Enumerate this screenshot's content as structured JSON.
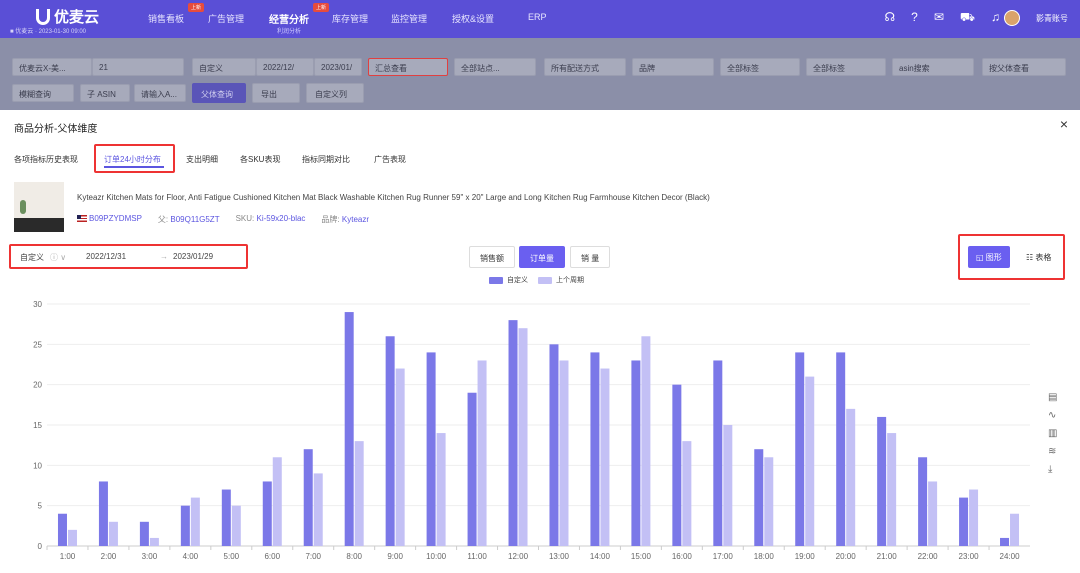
{
  "topnav": {
    "logo": "优麦云",
    "sub_logo": "■ 优麦云 · 2023-01-30 09:00",
    "items": [
      {
        "label": "销售看板",
        "badge": "上新"
      },
      {
        "label": "广告管理",
        "badge": ""
      },
      {
        "label": "经营分析",
        "sub": "利润分析",
        "badge": "上新"
      },
      {
        "label": "库存管理",
        "badge": ""
      },
      {
        "label": "监控管理",
        "badge": ""
      },
      {
        "label": "授权&设置",
        "badge": ""
      },
      {
        "label": "ERP",
        "badge": ""
      }
    ],
    "user": "影青账号"
  },
  "filters": {
    "row1": [
      "优麦云X-美...",
      "21",
      "自定义",
      "2022/12/",
      "2023/01/",
      "汇总查看",
      "全部站点...",
      "所有配送方式",
      "品牌",
      "全部标签",
      "全部标签",
      "asin搜索",
      "按父体查看"
    ],
    "row2": [
      "模糊查询",
      "子 ASIN",
      "请输入A...",
      "父体查询",
      "导出",
      "自定义列"
    ]
  },
  "modal": {
    "title": "商品分析-父体维度",
    "close": "×",
    "tabs": [
      "各项指标历史表现",
      "订单24小时分布",
      "支出明细",
      "各SKU表现",
      "指标同期对比",
      "广告表现"
    ],
    "active_tab": 1,
    "product": {
      "title": "Kyteazr Kitchen Mats for Floor, Anti Fatigue Cushioned Kitchen Mat Black Washable Kitchen Rug Runner 59\" x 20\" Large and Long Kitchen Rug Farmhouse Kitchen Decor (Black)",
      "asin": "B09PZYDMSP",
      "parent_label": "父:",
      "parent": "B09Q11G5ZT",
      "sku_label": "SKU:",
      "sku": "Ki-59x20-blac",
      "brand_label": "品牌:",
      "brand": "Kyteazr"
    },
    "date": {
      "mode": "自定义",
      "start": "2022/12/31",
      "arrow": "→",
      "end": "2023/01/29"
    },
    "metrics": [
      "销售额",
      "订单量",
      "销 量"
    ],
    "active_metric": 1,
    "views": {
      "chart": "图形",
      "table": "表格"
    }
  },
  "chart_data": {
    "type": "bar",
    "categories": [
      "1:00",
      "2:00",
      "3:00",
      "4:00",
      "5:00",
      "6:00",
      "7:00",
      "8:00",
      "9:00",
      "10:00",
      "11:00",
      "12:00",
      "13:00",
      "14:00",
      "15:00",
      "16:00",
      "17:00",
      "18:00",
      "19:00",
      "20:00",
      "21:00",
      "22:00",
      "23:00",
      "24:00"
    ],
    "series": [
      {
        "name": "自定义",
        "color": "#7b78e8",
        "values": [
          4,
          8,
          3,
          5,
          7,
          8,
          12,
          29,
          26,
          24,
          19,
          28,
          25,
          24,
          23,
          20,
          23,
          12,
          24,
          24,
          16,
          11,
          6,
          1
        ]
      },
      {
        "name": "上个周期",
        "color": "#c3c0f5",
        "values": [
          2,
          3,
          1,
          6,
          5,
          11,
          9,
          13,
          22,
          14,
          23,
          27,
          23,
          22,
          26,
          13,
          15,
          11,
          21,
          17,
          14,
          8,
          7,
          4
        ]
      }
    ],
    "ylim": [
      0,
      30
    ],
    "yticks": [
      0,
      5,
      10,
      15,
      20,
      25,
      30
    ],
    "grid": true,
    "legend_position": "top-center"
  }
}
